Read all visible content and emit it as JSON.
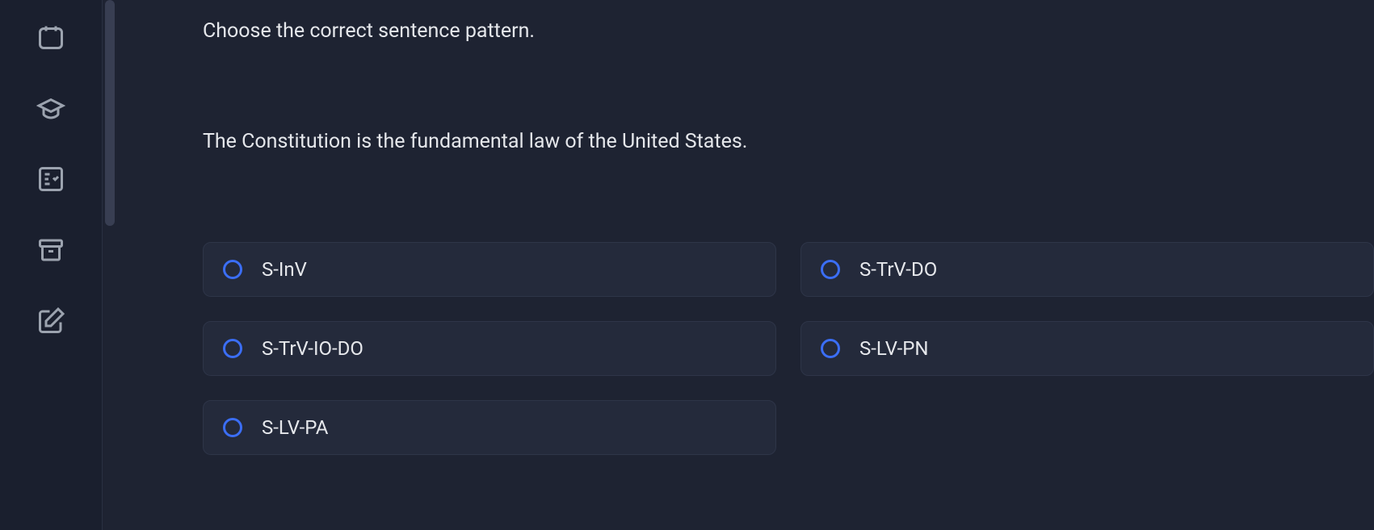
{
  "question": {
    "instruction": "Choose the correct sentence pattern.",
    "sentence": "The Constitution is the fundamental law of the United States."
  },
  "options": [
    {
      "label": "S-InV"
    },
    {
      "label": "S-TrV-DO"
    },
    {
      "label": "S-TrV-IO-DO"
    },
    {
      "label": "S-LV-PN"
    },
    {
      "label": "S-LV-PA"
    }
  ]
}
